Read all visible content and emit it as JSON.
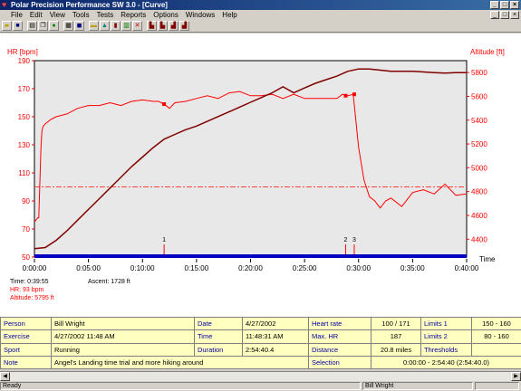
{
  "window": {
    "title": "Polar Precision Performance SW 3.0 - [Curve]"
  },
  "menu": [
    "File",
    "Edit",
    "View",
    "Tools",
    "Tests",
    "Reports",
    "Options",
    "Windows",
    "Help"
  ],
  "colors": {
    "hr": "#ff0000",
    "altitude": "#800000",
    "plot_bg": "#e8e8e8",
    "axis_bar": "#0000c0",
    "threshold": "#ff4040"
  },
  "toolbar": {
    "icons": [
      "open-icon",
      "save-icon",
      "print-icon",
      "copy-icon",
      "globe-icon",
      "calendar-icon",
      "book-icon",
      "folder-icon",
      "chart-icon",
      "bars-icon",
      "graph-icon",
      "stop-icon",
      "report1-icon",
      "report2-icon",
      "report3-icon",
      "report4-icon"
    ]
  },
  "chart_data": {
    "type": "line",
    "left_axis_label": "HR [bpm]",
    "right_axis_label": "Altitude [ft]",
    "x_axis_label": "Time",
    "x_ticks": [
      "0:00:00",
      "0:05:00",
      "0:10:00",
      "0:15:00",
      "0:20:00",
      "0:25:00",
      "0:30:00",
      "0:35:00",
      "0:40:00"
    ],
    "hr_ticks": [
      "190",
      "170",
      "150",
      "130",
      "110",
      "90",
      "70",
      "50"
    ],
    "alt_ticks": [
      "5800",
      "5600",
      "5400",
      "5200",
      "5000",
      "4800",
      "4600",
      "4400"
    ],
    "hr_range": [
      50,
      190
    ],
    "alt_range": [
      4250,
      5900
    ],
    "x_range_minutes": [
      0,
      40
    ],
    "threshold_hr": 100,
    "series": [
      {
        "name": "HR",
        "axis": "left",
        "x": [
          0,
          0.3,
          0.4,
          0.6,
          0.7,
          0.8,
          1.0,
          1.5,
          2,
          3,
          4,
          5,
          6,
          7,
          8,
          9,
          10,
          11,
          11.5,
          12,
          12.5,
          13,
          14,
          15,
          16,
          17,
          18,
          19,
          20,
          21,
          22,
          23,
          24,
          25,
          26,
          27,
          28,
          28.5,
          29,
          29.5,
          30,
          30.5,
          31,
          31.5,
          32,
          32.5,
          33,
          34,
          35,
          36,
          37,
          38,
          39,
          40
        ],
        "values": [
          75,
          78,
          78,
          128,
          140,
          143,
          145,
          148,
          150,
          152,
          156,
          158,
          158,
          160,
          158,
          161,
          162,
          161,
          161,
          159,
          156,
          160,
          161,
          163,
          165,
          163,
          167,
          168,
          165,
          165,
          166,
          163,
          166,
          163,
          163,
          163,
          163,
          166,
          165,
          166,
          128,
          105,
          93,
          90,
          85,
          90,
          92,
          86,
          96,
          98,
          95,
          102,
          94,
          95
        ]
      },
      {
        "name": "Altitude",
        "axis": "right",
        "x": [
          0,
          1,
          2,
          3,
          4,
          5,
          6,
          7,
          8,
          9,
          10,
          11,
          12,
          13,
          14,
          15,
          16,
          17,
          18,
          19,
          20,
          21,
          22,
          23,
          24,
          25,
          26,
          27,
          28,
          29,
          30,
          31,
          32,
          33,
          34,
          35,
          36,
          37,
          38,
          39,
          40
        ],
        "values": [
          4320,
          4330,
          4390,
          4470,
          4560,
          4650,
          4740,
          4830,
          4920,
          5010,
          5090,
          5170,
          5240,
          5280,
          5320,
          5350,
          5390,
          5430,
          5470,
          5510,
          5550,
          5590,
          5630,
          5680,
          5630,
          5670,
          5710,
          5740,
          5770,
          5810,
          5830,
          5830,
          5820,
          5810,
          5810,
          5810,
          5805,
          5800,
          5795,
          5800,
          5800
        ]
      }
    ],
    "lap_markers": [
      {
        "label": "1",
        "x": 12.0
      },
      {
        "label": "2",
        "x": 28.8
      },
      {
        "label": "3",
        "x": 29.6
      }
    ]
  },
  "readout": {
    "time": "Time: 0:39:55",
    "hr": "HR: 93 bpm",
    "altitude": "Altitude: 5795 ft",
    "ascent": "Ascent: 1728 ft"
  },
  "info": {
    "person_label": "Person",
    "person": "Bill Wright",
    "exercise_label": "Exercise",
    "exercise": "4/27/2002 11:48 AM",
    "sport_label": "Sport",
    "sport": "Running",
    "note_label": "Note",
    "note": "Angel's Landing time trial and more hiking around",
    "date_label": "Date",
    "date": "4/27/2002",
    "time_label": "Time",
    "time": "11:48:31 AM",
    "duration_label": "Duration",
    "duration": "2:54:40.4",
    "hr_label": "Heart rate",
    "hr": "100 / 171",
    "maxhr_label": "Max. HR",
    "maxhr": "187",
    "distance_label": "Distance",
    "distance": "20.8 miles",
    "selection_label": "Selection",
    "selection": "0:00:00 - 2:54:40 (2:54:40.0)",
    "limits1_label": "Limits 1",
    "limits1": "150 - 160",
    "limits2_label": "Limits 2",
    "limits2": "80 - 160",
    "thresholds_label": "Thresholds"
  },
  "status": {
    "left": "Ready",
    "user": "Bill Wright"
  }
}
